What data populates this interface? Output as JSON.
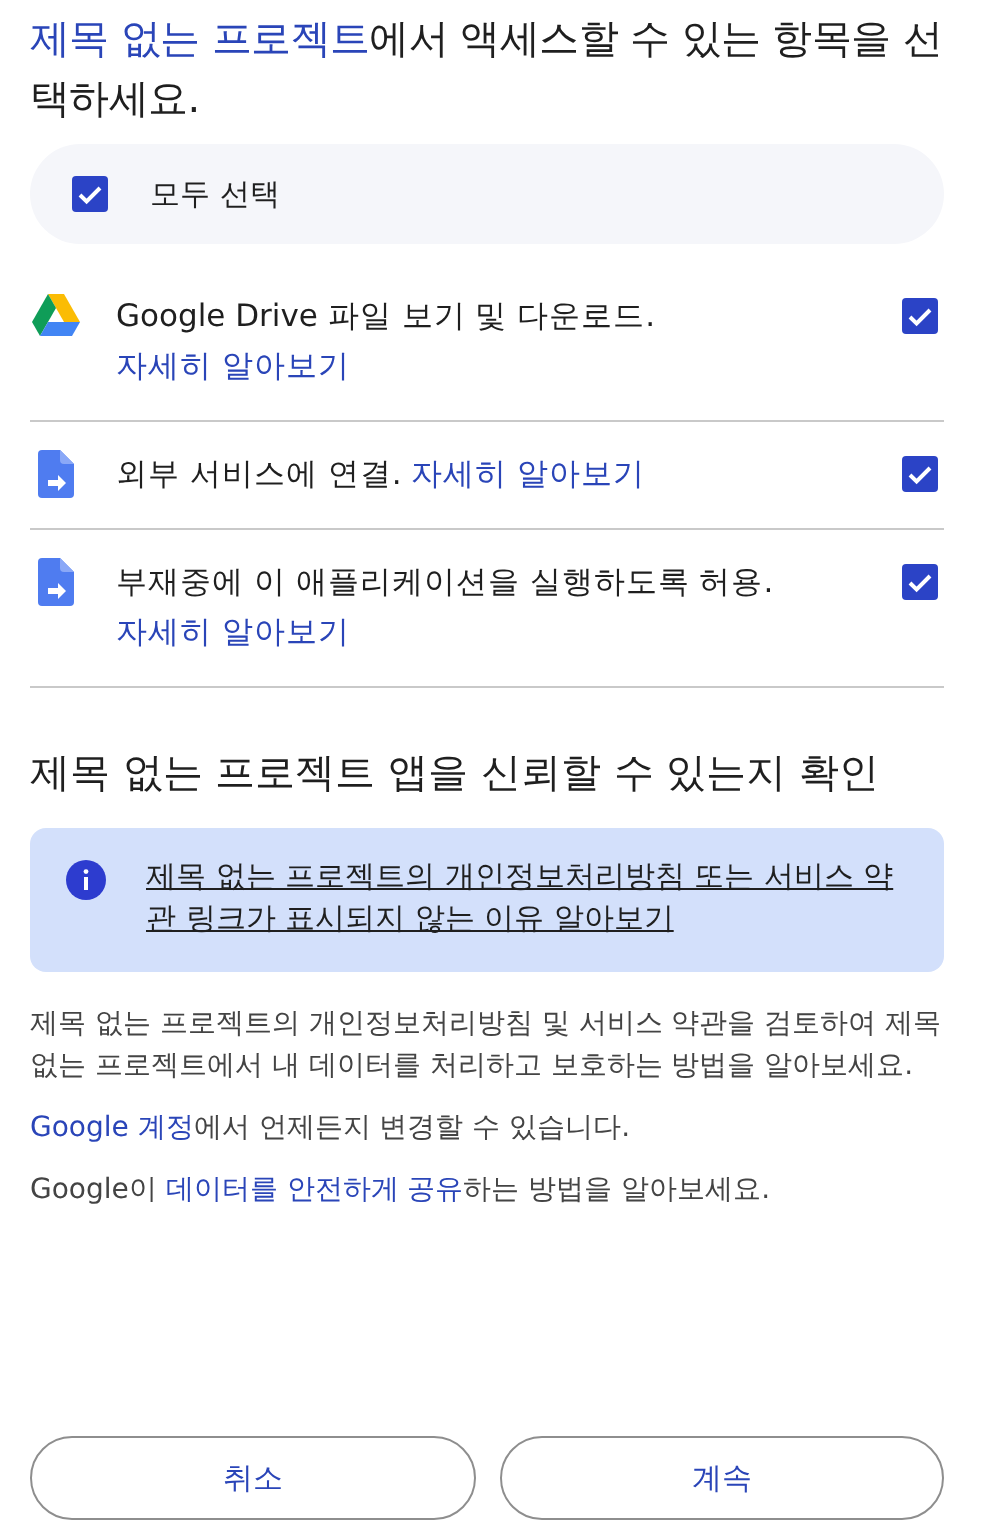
{
  "heading": {
    "app_name": "제목 없는 프로젝트",
    "text": "에서 액세스할 수 있는 항목을 선택하세요."
  },
  "select_all": {
    "label": "모두 선택",
    "checked": true
  },
  "permissions": [
    {
      "kind": "drive",
      "text": "Google Drive 파일 보기 및 다운로드.",
      "link": "자세히 알아보기",
      "checked": true
    },
    {
      "kind": "file",
      "text": "외부 서비스에 연결.",
      "link": "자세히 알아보기",
      "checked": true
    },
    {
      "kind": "file",
      "text": "부재중에 이 애플리케이션을 실행하도록 허용.",
      "link": "자세히 알아보기",
      "checked": true
    }
  ],
  "trust_title": "제목 없는 프로젝트 앱을 신뢰할 수 있는지 확인",
  "info_banner": {
    "link": "제목 없는 프로젝트의 개인정보처리방침 또는 서비스 약관 링크가 표시되지 않는 이유 알아보기"
  },
  "review_text": "제목 없는 프로젝트의 개인정보처리방침 및 서비스 약관을 검토하여 제목 없는 프로젝트에서 내 데이터를 처리하고 보호하는 방법을 알아보세요.",
  "account_line": {
    "link": "Google 계정",
    "text": "에서 언제든지 변경할 수 있습니다."
  },
  "sharing_line": {
    "before": "Google이 ",
    "link": "데이터를 안전하게 공유",
    "after": "하는 방법을 알아보세요."
  },
  "buttons": [
    "취소",
    "계속"
  ]
}
